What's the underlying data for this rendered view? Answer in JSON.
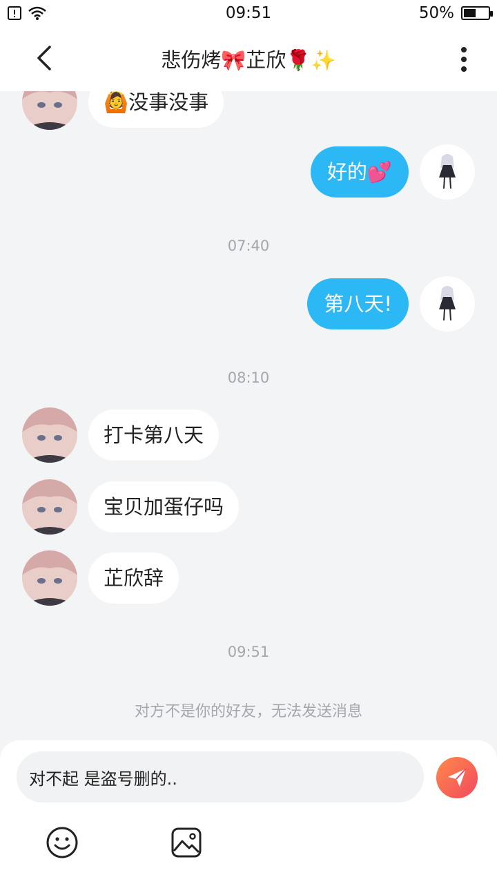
{
  "status_bar": {
    "time": "09:51",
    "battery_text": "50%",
    "battery_level": 0.5
  },
  "header": {
    "title": "悲伤烤🎀芷欣🌹✨"
  },
  "messages": [
    {
      "side": "in",
      "text": "🙆没事没事"
    },
    {
      "side": "out",
      "text": "好的💕"
    },
    {
      "type": "time",
      "text": "07:40"
    },
    {
      "side": "out",
      "text": "第八天!"
    },
    {
      "type": "time",
      "text": "08:10"
    },
    {
      "side": "in",
      "text": "打卡第八天"
    },
    {
      "side": "in",
      "text": "宝贝加蛋仔吗"
    },
    {
      "side": "in",
      "text": "芷欣辞"
    },
    {
      "type": "time",
      "text": "09:51"
    }
  ],
  "notice": "对方不是你的好友，无法发送消息",
  "composer": {
    "value": "对不起 是盗号删的.."
  },
  "colors": {
    "outgoing_bubble": "#2cb8f4",
    "send_gradient": [
      "#ff8a4a",
      "#f1495f"
    ]
  }
}
